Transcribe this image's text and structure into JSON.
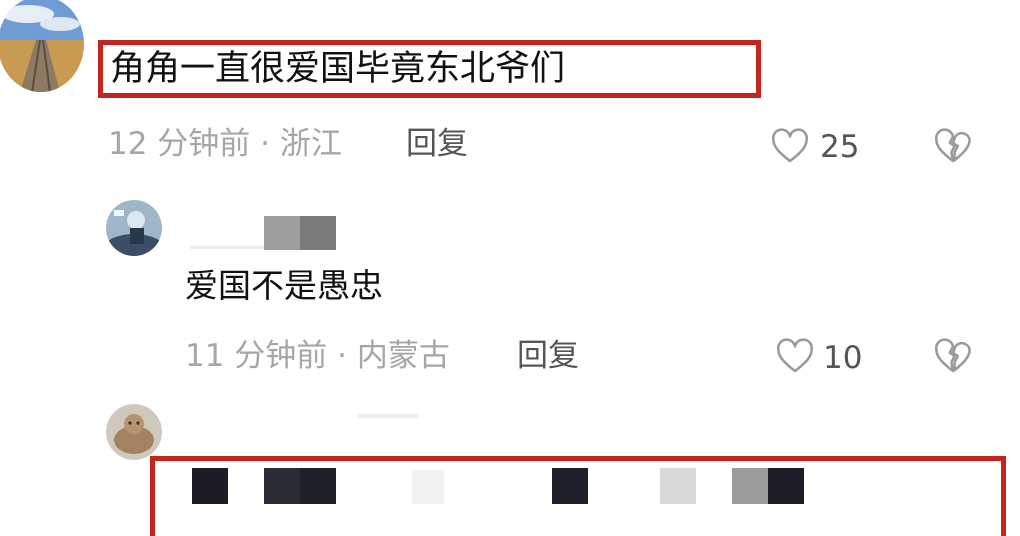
{
  "comments": [
    {
      "text": "角角一直很爱国毕竟东北爷们",
      "time_location": "12 分钟前 · 浙江",
      "reply_label": "回复",
      "like_count": "25"
    },
    {
      "text": "爱国不是愚忠",
      "time_location": "11 分钟前 · 内蒙古",
      "reply_label": "回复",
      "like_count": "10"
    },
    {
      "text": ""
    }
  ],
  "icons": {
    "like": "heart-outline-icon",
    "dislike": "broken-heart-icon"
  },
  "colors": {
    "highlight_border": "#c4261f",
    "meta_text": "#a6a6a6",
    "icon_gray": "#9a9a9a"
  }
}
